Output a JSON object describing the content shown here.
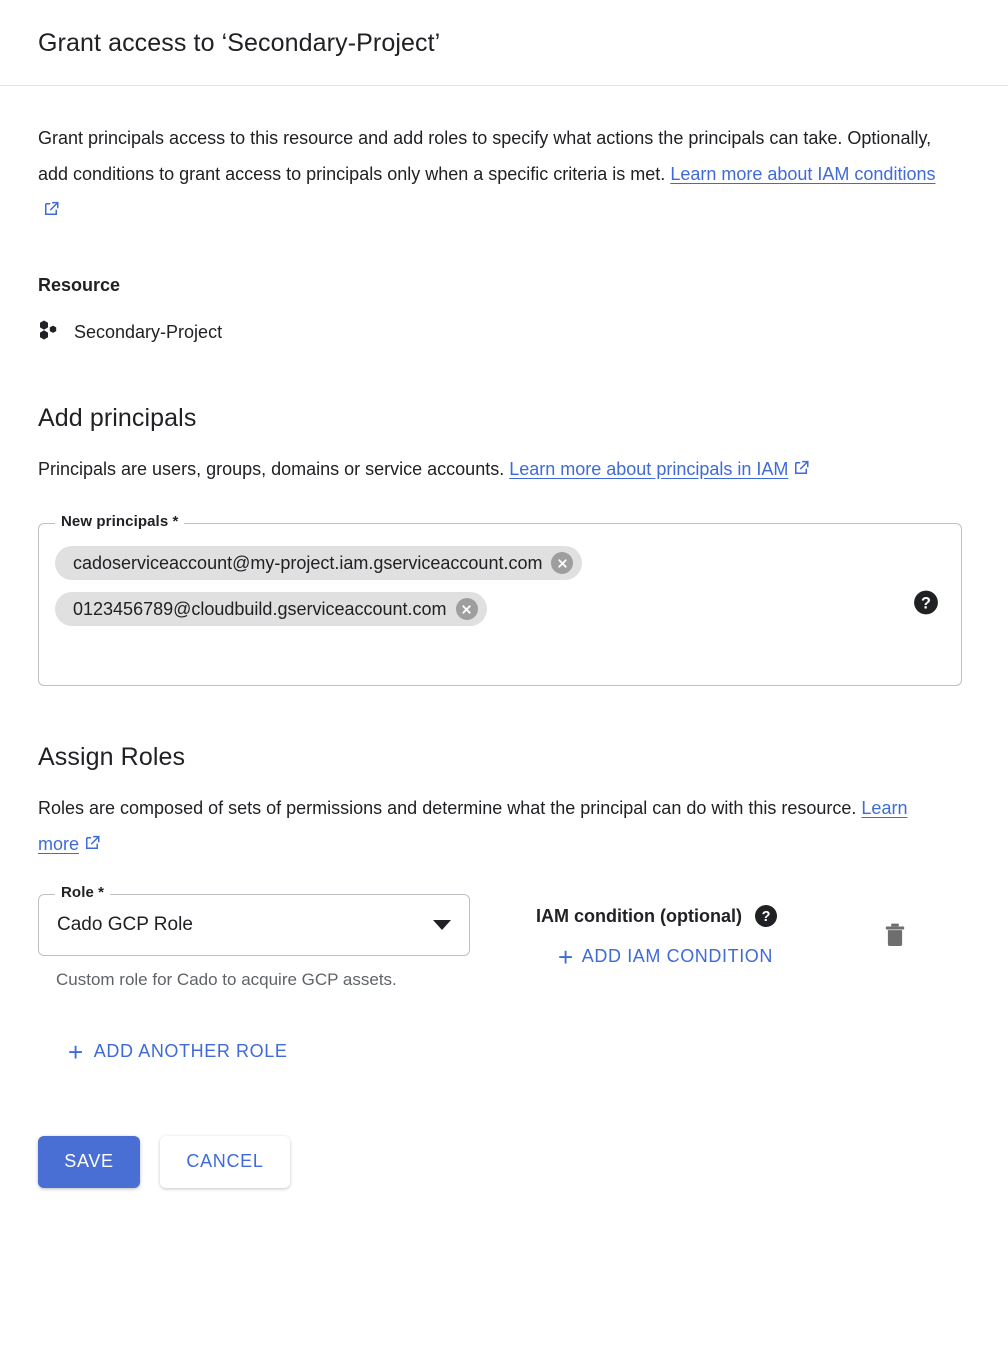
{
  "header": {
    "title": "Grant access to ‘Secondary-Project’"
  },
  "intro": {
    "text_before_link": "Grant principals access to this resource and add roles to specify what actions the principals can take. Optionally, add conditions to grant access to principals only when a specific criteria is met. ",
    "link_label": "Learn more about IAM conditions",
    "link_icon": "open-in-new-icon"
  },
  "resource": {
    "heading": "Resource",
    "icon": "project-icon",
    "name": "Secondary-Project"
  },
  "add_principals": {
    "heading": "Add principals",
    "description_before_link": "Principals are users, groups, domains or service accounts. ",
    "link_label": "Learn more about principals in IAM",
    "link_icon": "open-in-new-icon",
    "field_label": "New principals *",
    "help_icon": "help-icon",
    "chips": [
      {
        "label": "cadoserviceaccount@my-project.iam.gserviceaccount.com",
        "remove_icon": "remove-circle-icon"
      },
      {
        "label": "0123456789@cloudbuild.gserviceaccount.com",
        "remove_icon": "remove-circle-icon"
      }
    ]
  },
  "assign_roles": {
    "heading": "Assign Roles",
    "description_before_link": "Roles are composed of sets of permissions and determine what the principal can do with this resource. ",
    "link_label": "Learn more",
    "link_icon": "open-in-new-icon",
    "role_field": {
      "label": "Role *",
      "value": "Cado GCP Role",
      "hint": "Custom role for Cado to acquire GCP assets.",
      "dropdown_icon": "chevron-down-icon"
    },
    "condition": {
      "label": "IAM condition (optional)",
      "help_icon": "help-icon",
      "add_label": "ADD IAM CONDITION",
      "add_icon": "plus-icon"
    },
    "delete_icon": "trash-icon",
    "add_another_role_label": "ADD ANOTHER ROLE",
    "add_another_role_icon": "plus-icon"
  },
  "footer": {
    "save_label": "SAVE",
    "cancel_label": "CANCEL"
  },
  "colors": {
    "link_blue": "#3f6ad8",
    "save_blue": "#4a6fd4",
    "chip_gray": "#e0e0e0",
    "border_gray": "#bdc1c6",
    "hint_gray": "#5f6368",
    "text_primary": "#202124"
  }
}
